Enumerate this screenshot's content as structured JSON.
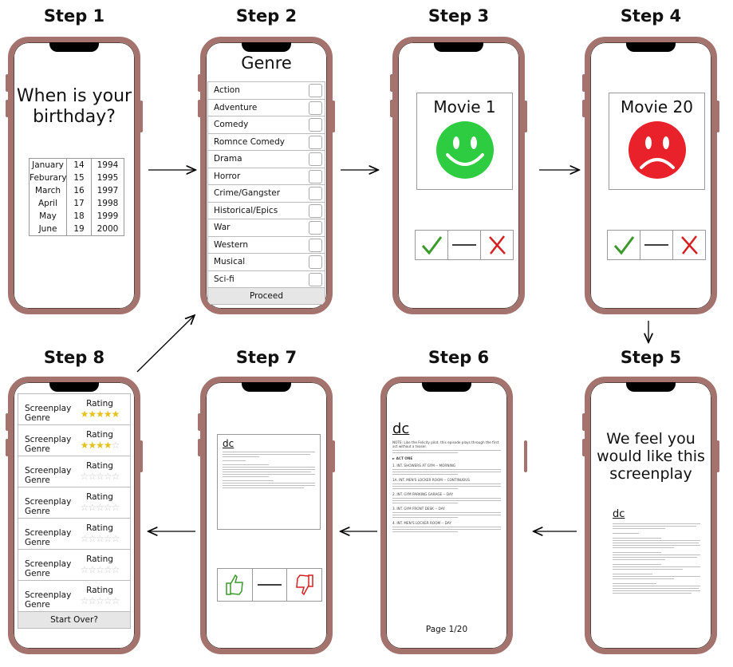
{
  "steps": {
    "s1": "Step 1",
    "s2": "Step 2",
    "s3": "Step 3",
    "s4": "Step 4",
    "s5": "Step 5",
    "s6": "Step 6",
    "s7": "Step 7",
    "s8": "Step 8"
  },
  "step1": {
    "question": "When is your birthday?",
    "rows": [
      [
        "January",
        "14",
        "1994"
      ],
      [
        "Feburary",
        "15",
        "1995"
      ],
      [
        "March",
        "16",
        "1997"
      ],
      [
        "April",
        "17",
        "1998"
      ],
      [
        "May",
        "18",
        "1999"
      ],
      [
        "June",
        "19",
        "2000"
      ]
    ]
  },
  "step2": {
    "title": "Genre",
    "genres": [
      "Action",
      "Adventure",
      "Comedy",
      "Romnce Comedy",
      "Drama",
      "Horror",
      "Crime/Gangster",
      "Historical/Epics",
      "War",
      "Western",
      "Musical",
      "Sci-fi"
    ],
    "proceed": "Proceed"
  },
  "step3": {
    "movie": "Movie 1",
    "face": "smiley-icon",
    "face_color": "#2ecc40"
  },
  "step4": {
    "movie": "Movie 20",
    "face": "sad-face-icon",
    "face_color": "#e8212b"
  },
  "step5": {
    "message": "We feel you would like this screenplay",
    "logo": "dc"
  },
  "step6": {
    "logo": "dc",
    "script_lines": [
      "NOTE: Like the Felicity pilot, this episode plays through the first act without a teaser.",
      "► ACT ONE",
      "1.  INT. SHOWERS AT GYM -- MORNING",
      "1A.  INT. MEN'S LOCKER ROOM -- CONTINUOUS",
      "2.  INT. GYM PARKING GARAGE -- DAY",
      "3.  INT. GYM FRONT DESK -- DAY",
      "4.  INT. MEN'S LOCKER ROOM -- DAY"
    ],
    "page": "Page 1/20"
  },
  "step7": {
    "logo": "dc"
  },
  "step8": {
    "rows": [
      {
        "title": "Screenplay",
        "subtitle": "Genre",
        "rating_label": "Rating",
        "rating": 5
      },
      {
        "title": "Screenplay",
        "subtitle": "Genre",
        "rating_label": "Rating",
        "rating": 4
      },
      {
        "title": "Screenplay",
        "subtitle": "Genre",
        "rating_label": "Rating",
        "rating": 0
      },
      {
        "title": "Screenplay",
        "subtitle": "Genre",
        "rating_label": "Rating",
        "rating": 0
      },
      {
        "title": "Screenplay",
        "subtitle": "Genre",
        "rating_label": "Rating",
        "rating": 0
      },
      {
        "title": "Screenplay",
        "subtitle": "Genre",
        "rating_label": "Rating",
        "rating": 0
      },
      {
        "title": "Screenplay",
        "subtitle": "Genre",
        "rating_label": "Rating",
        "rating": 0
      }
    ],
    "start_over": "Start Over?",
    "rating_max": 5
  },
  "colors": {
    "phone_frame": "#a4736d",
    "check_green": "#3a9a2a",
    "cross_red": "#d42020",
    "star_yellow": "#e4c21a"
  }
}
